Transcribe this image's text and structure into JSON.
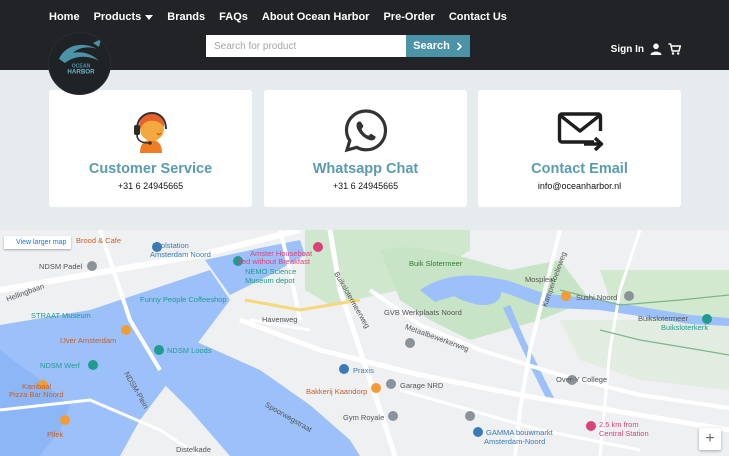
{
  "nav": [
    {
      "label": "Home"
    },
    {
      "label": "Products"
    },
    {
      "label": "Brands"
    },
    {
      "label": "FAQs"
    },
    {
      "label": "About Ocean Harbor"
    },
    {
      "label": "Pre-Order"
    },
    {
      "label": "Contact Us"
    }
  ],
  "logo": {
    "line1": "OCEAN",
    "line2": "HARBOR"
  },
  "search": {
    "placeholder": "Search for product",
    "button": "Search"
  },
  "account": {
    "signin": "Sign In"
  },
  "cards": [
    {
      "title": "Customer Service",
      "sub": "+31 6 24945665",
      "icon": "headset-agent-icon"
    },
    {
      "title": "Whatsapp Chat",
      "sub": "+31 6 24945665",
      "icon": "whatsapp-icon"
    },
    {
      "title": "Contact Email",
      "sub": "info@oceanharbor.nl",
      "icon": "envelope-arrow-icon"
    }
  ],
  "map": {
    "view_larger": "View larger map",
    "zoom_in": "+",
    "labels": [
      {
        "text": "Brood & Cafe",
        "color": "#c5602c"
      },
      {
        "text": "Toolstation",
        "color": "#3a7ab8"
      },
      {
        "text": "Amsterdam Noord",
        "color": "#3a7ab8"
      },
      {
        "text": "Amster Houseboat",
        "color": "#d9437a"
      },
      {
        "text": "Bed without Breakfast",
        "color": "#d9437a"
      },
      {
        "text": "NEMO Science",
        "color": "#1e9c8f"
      },
      {
        "text": "Museum depot",
        "color": "#1e9c8f"
      },
      {
        "text": "NDSM Padel",
        "color": "#555"
      },
      {
        "text": "Funny People Coffeeshop",
        "color": "#1e9c8f"
      },
      {
        "text": "STRAAT Museum",
        "color": "#1e9c8f"
      },
      {
        "text": "IJver Amsterdam",
        "color": "#c5602c"
      },
      {
        "text": "NDSM Loods",
        "color": "#1e9c8f"
      },
      {
        "text": "NDSM Werf",
        "color": "#1e9c8f"
      },
      {
        "text": "Kanibaal",
        "color": "#c5602c"
      },
      {
        "text": "Pizza Bar Noord",
        "color": "#c5602c"
      },
      {
        "text": "Pllek",
        "color": "#c5602c"
      },
      {
        "text": "Praxis",
        "color": "#3a7ab8"
      },
      {
        "text": "Garage NRD",
        "color": "#555"
      },
      {
        "text": "Bakkerij Kaandorp",
        "color": "#c5602c"
      },
      {
        "text": "Gym Royale",
        "color": "#555"
      },
      {
        "text": "GVB Werkplaats Noord",
        "color": "#555"
      },
      {
        "text": "Buik Slotermeer",
        "color": "#2f7d32"
      },
      {
        "text": "Sushi Noord",
        "color": "#555"
      },
      {
        "text": "Buikslotermeer",
        "color": "#555"
      },
      {
        "text": "Buiksloterkerk",
        "color": "#1e9c8f"
      },
      {
        "text": "Over-Y College",
        "color": "#555"
      },
      {
        "text": "2.5 km from",
        "color": "#d9437a"
      },
      {
        "text": "Central Station",
        "color": "#d9437a"
      },
      {
        "text": "GAMMA bouwmarkt",
        "color": "#3a7ab8"
      },
      {
        "text": "Amsterdam-Noord",
        "color": "#3a7ab8"
      },
      {
        "text": "Havenweg",
        "color": "#555"
      },
      {
        "text": "Buikslotermeerweg",
        "color": "#555"
      },
      {
        "text": "Metaalbewerkerweg",
        "color": "#555"
      },
      {
        "text": "Kamperfoelieweg",
        "color": "#555"
      },
      {
        "text": "Mosplein",
        "color": "#555"
      },
      {
        "text": "Hellingbaan",
        "color": "#555"
      },
      {
        "text": "NDSM-Plein",
        "color": "#555"
      },
      {
        "text": "Distelkade",
        "color": "#555"
      },
      {
        "text": "Spoorwegstraat",
        "color": "#555"
      }
    ]
  },
  "colors": {
    "header_bg": "#212326",
    "accent": "#4b93a6",
    "card_title": "#5a9bb1",
    "page_bg": "#e6ebee"
  }
}
